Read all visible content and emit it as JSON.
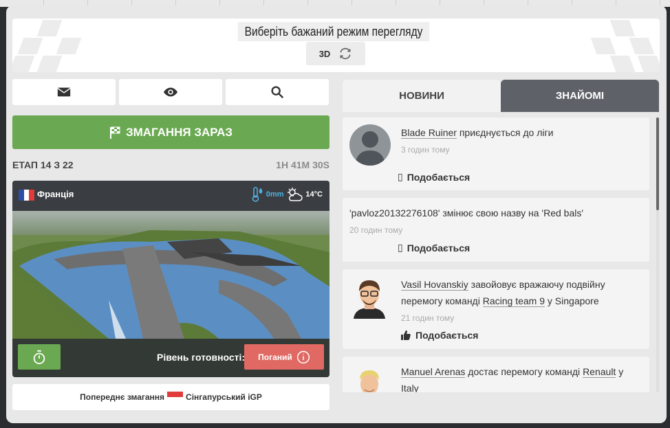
{
  "header": {
    "title": "Виберіть бажаний режим перегляду перегонів:",
    "mode_label": "3D",
    "mode_icon": "refresh-icon"
  },
  "toolbar": {
    "mail_icon": "mail-icon",
    "view_icon": "eye-icon",
    "search_icon": "search-icon"
  },
  "race_now": {
    "label": "ЗМАГАННЯ ЗАРАЗ",
    "icon": "checkered-flag-icon"
  },
  "stage": {
    "label": "ЕТАП 14 З 22",
    "countdown": "1H 41M 30S"
  },
  "track": {
    "country": "Франція",
    "rain": "0mm",
    "temperature": "14°C",
    "readiness_label": "Рівень готовності:",
    "readiness_value": "Поганий"
  },
  "previous_race": {
    "label": "Попереднє змагання",
    "race": "Сінгапурський iGP"
  },
  "tabs": [
    {
      "label": "НОВИНИ",
      "active": true
    },
    {
      "label": "ЗНАЙОМІ",
      "active": false
    }
  ],
  "feed": [
    {
      "user": "Blade Ruiner",
      "text": "приєднується до ліги",
      "time": "3 годин тому",
      "like": "Подобається"
    },
    {
      "text": "'pavloz20132276108' змінює свою назву на 'Red bals'",
      "time": "20 годин тому",
      "like": "Подобається"
    },
    {
      "user": "Vasil Hovanskiy",
      "text1": "завойовує вражаючу подвійну",
      "text2": "перемогу команді",
      "team": "Racing team 9",
      "text3": "у Singapore",
      "time": "21 годин тому",
      "like": "Подобається"
    },
    {
      "user": "Manuel Arenas",
      "text1": "достає перемогу команді",
      "team": "Renault",
      "text2": "у",
      "text3": "Italy"
    }
  ],
  "colors": {
    "green": "#6aa951",
    "red": "#e06a63",
    "dark_tab": "#5e6268",
    "background": "#e8e8e8"
  }
}
